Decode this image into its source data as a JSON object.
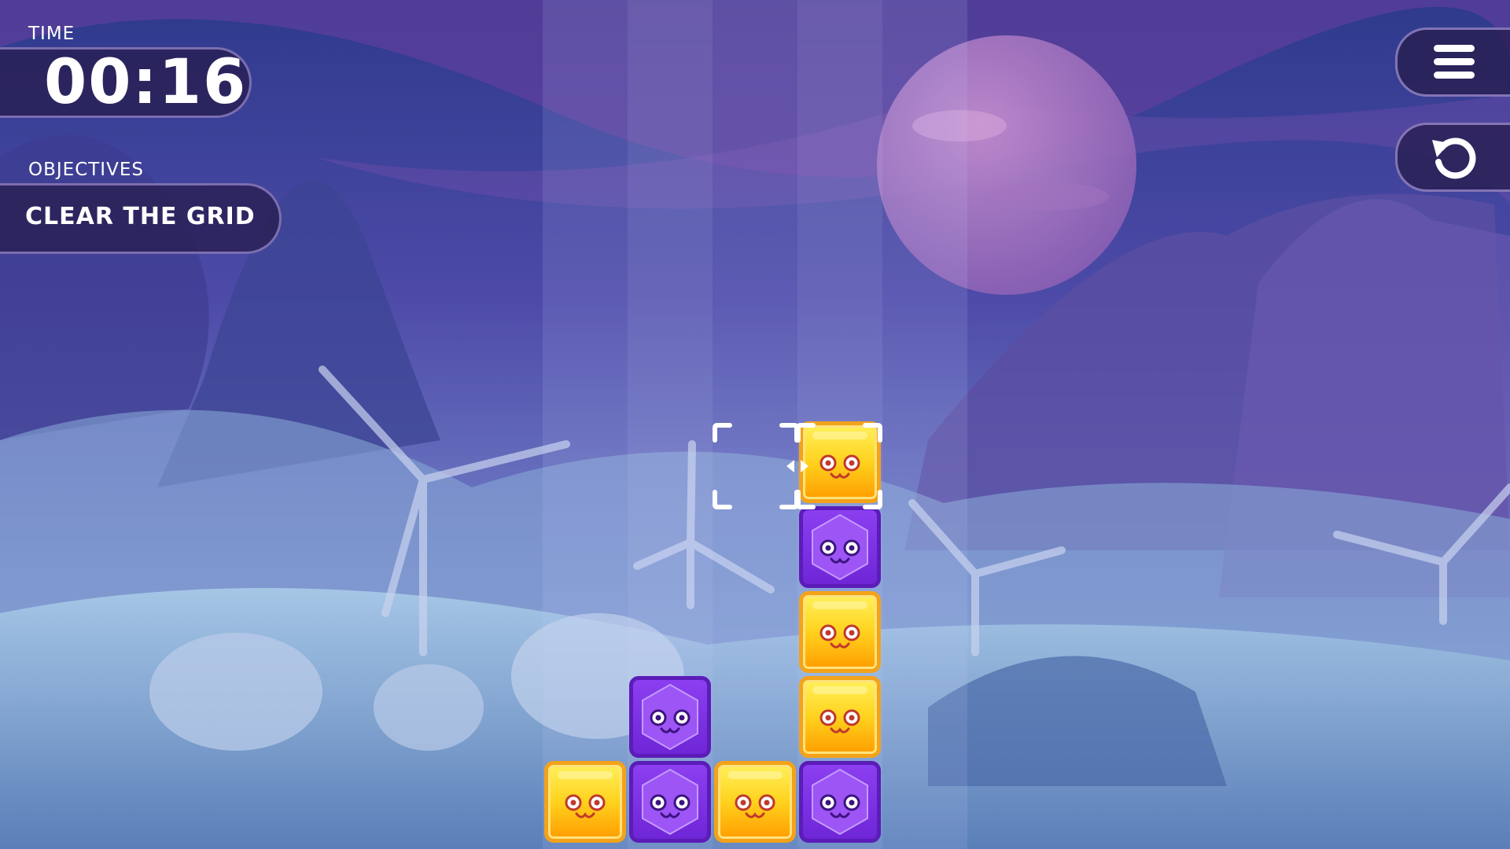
{
  "hud": {
    "time_label": "TIME",
    "time_value": "00:16",
    "objectives_label": "OBJECTIVES",
    "objective_text": "CLEAR THE GRID"
  },
  "buttons": {
    "menu_icon": "hamburger-menu-icon",
    "restart_icon": "restart-icon"
  },
  "colors": {
    "yellow_block": "#ffd21e",
    "purple_block": "#7b2fe0",
    "hud_panel": "#2a1f55"
  },
  "grid": {
    "columns": 5,
    "selected_cell": {
      "column": 3,
      "row": 6
    },
    "blocks": [
      {
        "column": 1,
        "row": 1,
        "type": "yellow"
      },
      {
        "column": 2,
        "row": 1,
        "type": "purple"
      },
      {
        "column": 3,
        "row": 1,
        "type": "yellow"
      },
      {
        "column": 4,
        "row": 1,
        "type": "purple"
      },
      {
        "column": 2,
        "row": 2,
        "type": "purple"
      },
      {
        "column": 4,
        "row": 2,
        "type": "yellow"
      },
      {
        "column": 4,
        "row": 3,
        "type": "yellow"
      },
      {
        "column": 4,
        "row": 4,
        "type": "purple"
      },
      {
        "column": 4,
        "row": 5,
        "type": "yellow"
      }
    ]
  }
}
